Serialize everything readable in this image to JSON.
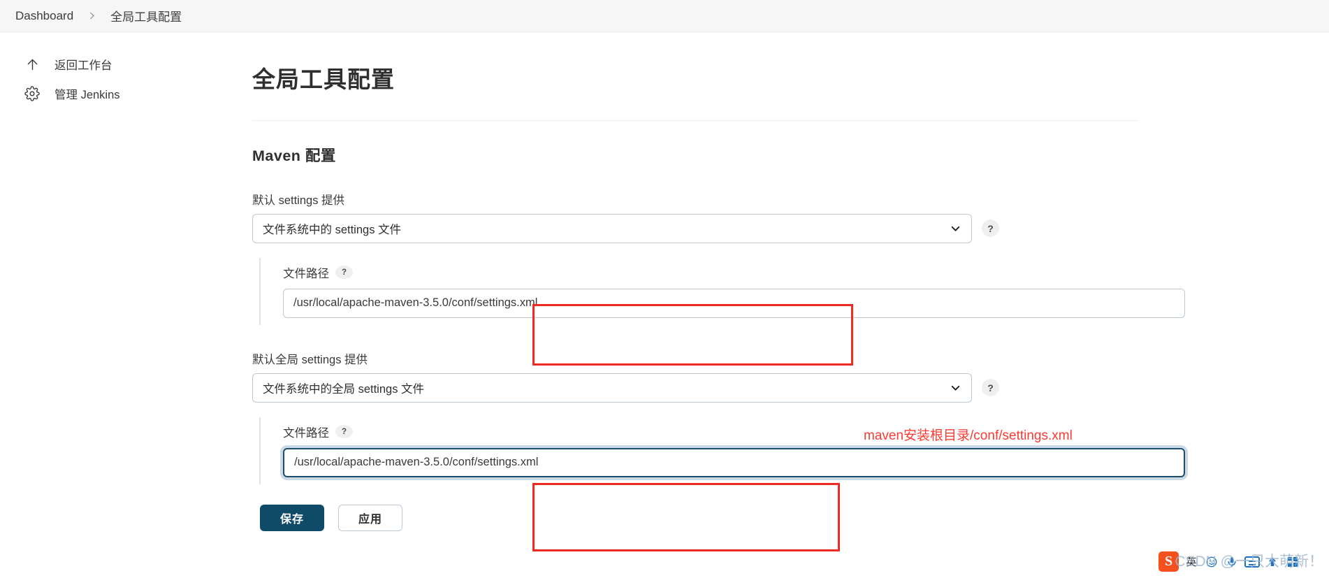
{
  "breadcrumb": {
    "items": [
      {
        "label": "Dashboard",
        "icon": ""
      },
      {
        "label": "全局工具配置",
        "icon": ""
      }
    ],
    "separator_icon": "chevron-right-icon"
  },
  "sidebar": {
    "items": [
      {
        "label": "返回工作台",
        "icon": "arrow-up-icon"
      },
      {
        "label": "管理 Jenkins",
        "icon": "gear-icon"
      }
    ]
  },
  "main": {
    "page_title": "全局工具配置",
    "section": {
      "title": "Maven 配置",
      "fields": [
        {
          "label": "默认 settings 提供",
          "select_value": "文件系统中的 settings 文件",
          "select_icon": "chevron-down-icon",
          "help_icon": "question-mark-icon",
          "help_label": "?",
          "nested": {
            "label": "文件路径",
            "help_label": "?",
            "help_icon": "question-mark-icon",
            "input_value": "/usr/local/apache-maven-3.5.0/conf/settings.xml",
            "input_placeholder": "",
            "focused": false
          }
        },
        {
          "label": "默认全局 settings 提供",
          "select_value": "文件系统中的全局 settings 文件",
          "select_icon": "chevron-down-icon",
          "help_icon": "question-mark-icon",
          "help_label": "?",
          "nested": {
            "label": "文件路径",
            "help_label": "?",
            "help_icon": "question-mark-icon",
            "input_value": "/usr/local/apache-maven-3.5.0/conf/settings.xml",
            "input_placeholder": "",
            "focused": true
          }
        }
      ]
    },
    "annotation": {
      "text": "maven安装根目录/conf/settings.xml",
      "color": "#fb3b33"
    },
    "highlight_color": "#f02a22",
    "buttons": {
      "save_label": "保存",
      "apply_label": "应用"
    }
  },
  "taskbar": {
    "ime_logo": "S",
    "ime_logo_name": "sogou-ime-logo",
    "items": [
      {
        "label": "英",
        "icon": "language-toggle-icon"
      },
      {
        "label": "",
        "icon": "emoji-icon"
      },
      {
        "label": "",
        "icon": "microphone-icon"
      },
      {
        "label": "",
        "icon": "keyboard-icon"
      },
      {
        "label": "",
        "icon": "upload-arrow-icon"
      },
      {
        "label": "",
        "icon": "app-grid-icon"
      }
    ],
    "watermark": "CSDN @一只大萌新！"
  },
  "colors": {
    "accent": "#104a69",
    "focus_border": "#1d4e6e",
    "focus_ring": "#ccdae6",
    "border": "#bdc8d1",
    "header_bg": "#f6f6f7"
  }
}
